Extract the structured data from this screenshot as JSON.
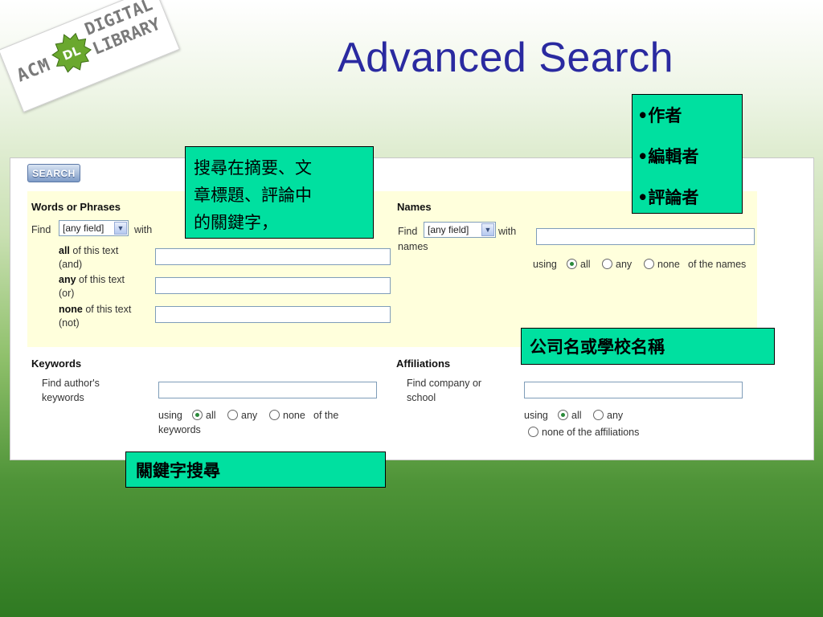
{
  "logo": {
    "acm": "ACM",
    "badge": "DL",
    "digital": "DIGITAL",
    "library": "LIBRARY",
    "badge_color": "#6aa82e"
  },
  "title": "Advanced Search",
  "search_button": "SEARCH",
  "words": {
    "heading": "Words or Phrases",
    "find": "Find",
    "field_value": "[any field]",
    "with": "with",
    "all_bold": "all",
    "all_rest": " of this text",
    "all_sub": "(and)",
    "any_bold": "any",
    "any_rest": " of this text",
    "any_sub": "(or)",
    "none_bold": "none",
    "none_rest": " of this text",
    "none_sub": "(not)"
  },
  "names": {
    "heading": "Names",
    "find": "Find",
    "field_value": "[any field]",
    "with": "with",
    "names": "names",
    "using": "using",
    "opt_all": "all",
    "opt_any": "any",
    "opt_none": "none",
    "of_the_names": "of the names"
  },
  "keywords": {
    "heading": "Keywords",
    "find_line1": "Find author's",
    "find_line2": "keywords",
    "using": "using",
    "opt_all": "all",
    "opt_any": "any",
    "opt_none": "none",
    "of_the": "of the",
    "keywords_word": "keywords"
  },
  "affiliations": {
    "heading": "Affiliations",
    "find_line1": "Find company or",
    "find_line2": "school",
    "using": "using",
    "opt_all": "all",
    "opt_any": "any",
    "opt_none": "none of the affiliations"
  },
  "notes": {
    "keyword_line1": "搜尋在摘要、文",
    "keyword_line2": "章標題、評論中",
    "keyword_line3": "的關鍵字，",
    "author": "•作者",
    "editor": "•編輯者",
    "reviewer": "•評論者",
    "affiliation": "公司名或學校名稱",
    "keyword_search": "關鍵字搜尋",
    "note_color": "#00e0a0"
  }
}
